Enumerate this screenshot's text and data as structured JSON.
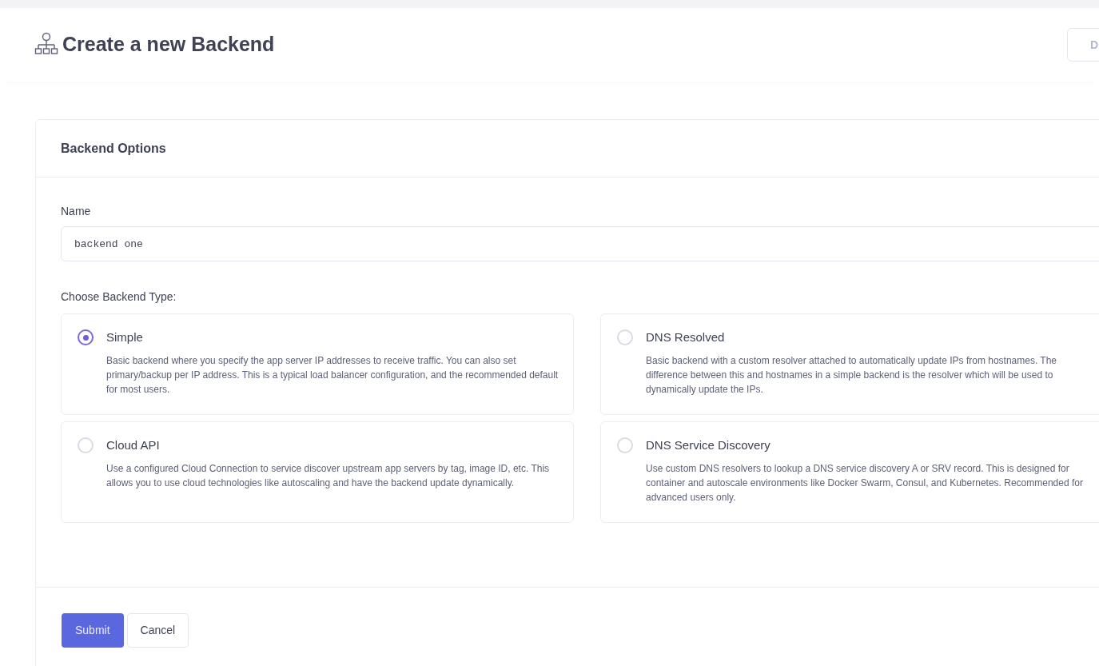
{
  "page_title": "Create a new Backend",
  "header_button": "D",
  "card": {
    "title": "Backend Options",
    "name_field": {
      "label": "Name",
      "value": "backend one"
    },
    "type_label": "Choose Backend Type:",
    "types": [
      {
        "title": "Simple",
        "selected": true,
        "description": "Basic backend where you specify the app server IP addresses to receive traffic. You can also set primary/backup per IP address. This is a typical load balancer configuration, and the recommended default for most users."
      },
      {
        "title": "DNS Resolved",
        "selected": false,
        "description": "Basic backend with a custom resolver attached to automatically update IPs from hostnames. The difference between this and hostnames in a simple backend is the resolver which will be used to dynamically update the IPs."
      },
      {
        "title": "Cloud API",
        "selected": false,
        "description": "Use a configured Cloud Connection to service discover upstream app servers by tag, image ID, etc. This allows you to use cloud technologies like autoscaling and have the backend update dynamically."
      },
      {
        "title": "DNS Service Discovery",
        "selected": false,
        "description": "Use custom DNS resolvers to lookup a DNS service discovery A or SRV record. This is designed for container and autoscale environments like Docker Swarm, Consul, and Kubernetes. Recommended for advanced users only."
      }
    ],
    "buttons": [
      "Submit",
      "Cancel"
    ]
  }
}
